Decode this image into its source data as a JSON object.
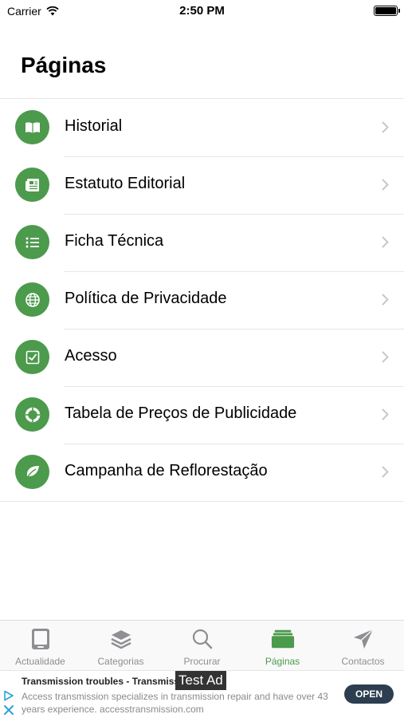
{
  "status_bar": {
    "carrier": "Carrier",
    "time": "2:50 PM"
  },
  "page": {
    "title": "Páginas"
  },
  "list": [
    {
      "label": "Historial",
      "icon": "book-icon"
    },
    {
      "label": "Estatuto Editorial",
      "icon": "document-icon"
    },
    {
      "label": "Ficha Técnica",
      "icon": "list-icon"
    },
    {
      "label": "Política de Privacidade",
      "icon": "globe-icon"
    },
    {
      "label": "Acesso",
      "icon": "checkbox-icon"
    },
    {
      "label": "Tabela de Preços de Publicidade",
      "icon": "lifebuoy-icon"
    },
    {
      "label": "Campanha de Reflorestação",
      "icon": "leaf-icon"
    }
  ],
  "tabs": [
    {
      "label": "Actualidade",
      "icon": "tablet-icon",
      "active": false
    },
    {
      "label": "Categorias",
      "icon": "layers-icon",
      "active": false
    },
    {
      "label": "Procurar",
      "icon": "search-icon",
      "active": false
    },
    {
      "label": "Páginas",
      "icon": "folder-icon",
      "active": true
    },
    {
      "label": "Contactos",
      "icon": "send-icon",
      "active": false
    }
  ],
  "ad": {
    "headline": "Transmission troubles - Transmission",
    "body": "Access transmission specializes in transmission repair and have over 43 years experience. accesstransmission.com",
    "tag": "Test Ad",
    "cta": "OPEN"
  },
  "colors": {
    "accent": "#4c9a4c",
    "separator": "#e6e6e6",
    "inactive_tab": "#8e8e93"
  }
}
